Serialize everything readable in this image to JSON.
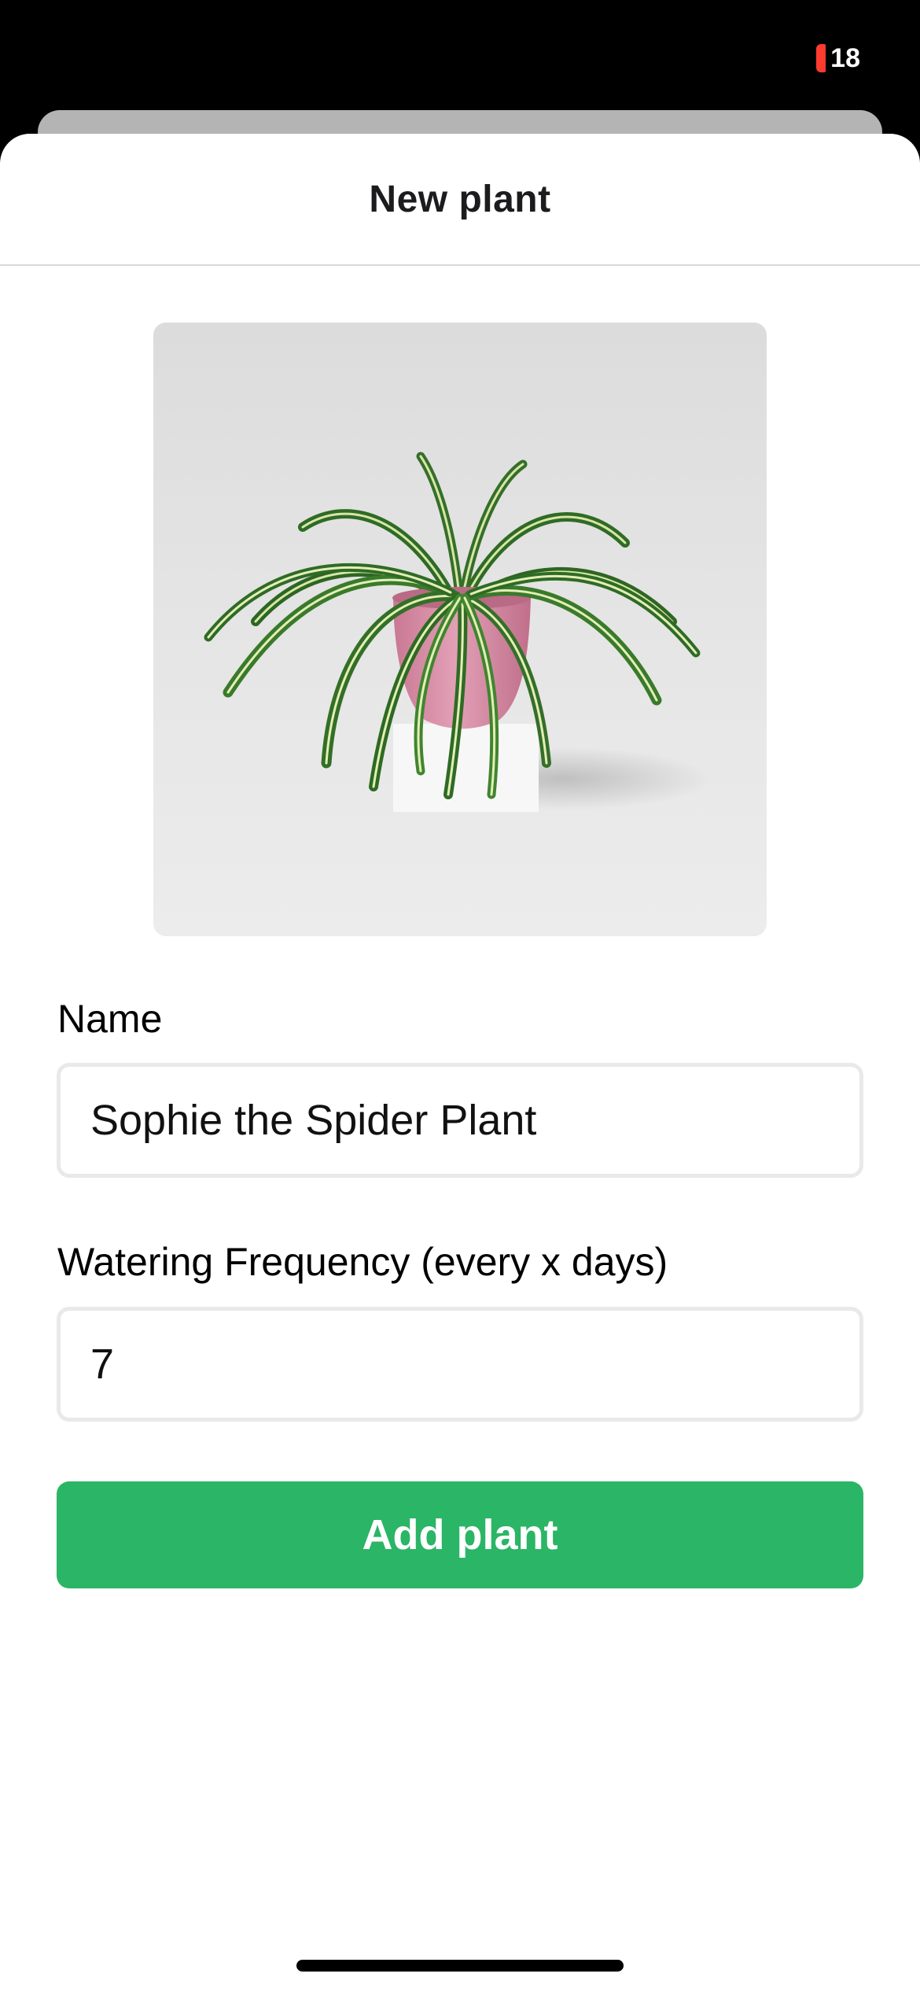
{
  "status_bar": {
    "battery_percent": "18",
    "battery_color": "#ff3b30"
  },
  "sheet": {
    "title": "New plant"
  },
  "photo": {
    "subject": "spider plant in pink pot on white pedestal",
    "pot_color": "#d98fa8"
  },
  "form": {
    "name_label": "Name",
    "name_value": "Sophie the Spider Plant",
    "frequency_label": "Watering Frequency (every x days)",
    "frequency_value": "7",
    "submit_label": "Add plant",
    "submit_color": "#2bb566"
  }
}
